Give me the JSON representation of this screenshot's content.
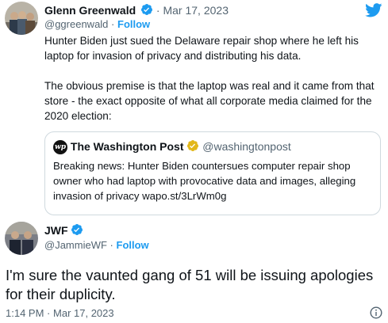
{
  "tweet": {
    "author_name": "Glenn Greenwald",
    "separator": "·",
    "date": "Mar 17, 2023",
    "handle": "@ggreenwald",
    "follow_label": "Follow",
    "body_lines": [
      "Hunter Biden just sued the Delaware repair shop where he left his",
      "laptop for invasion of privacy and distributing his data.",
      "",
      "The obvious premise is that the laptop was real and it came from that",
      "store - the exact opposite of what all corporate media claimed for the",
      "2020 election:"
    ],
    "quote": {
      "author_name": "The Washington Post",
      "handle": "@washingtonpost",
      "logo_text": "wp",
      "body_lines": [
        "Breaking news: Hunter Biden countersues computer repair shop",
        "owner who had laptop with provocative data and images, alleging",
        "invasion of privacy wapo.st/3LrWm0g"
      ]
    }
  },
  "reply": {
    "author_name": "JWF",
    "handle": "@JammieWF",
    "separator": "·",
    "follow_label": "Follow",
    "body_lines": [
      "I'm sure the vaunted gang of 51 will be issuing apologies",
      "for their duplicity."
    ],
    "time": "1:14 PM",
    "date": "Mar 17, 2023"
  },
  "colors": {
    "accent": "#1d9bf0",
    "verified_gold": "#e2b719",
    "text": "#0f1419",
    "muted": "#536471",
    "border": "#cfd9de"
  },
  "icons": [
    "twitter-bird-icon",
    "verified-badge-icon",
    "info-icon",
    "washington-post-logo-icon"
  ]
}
